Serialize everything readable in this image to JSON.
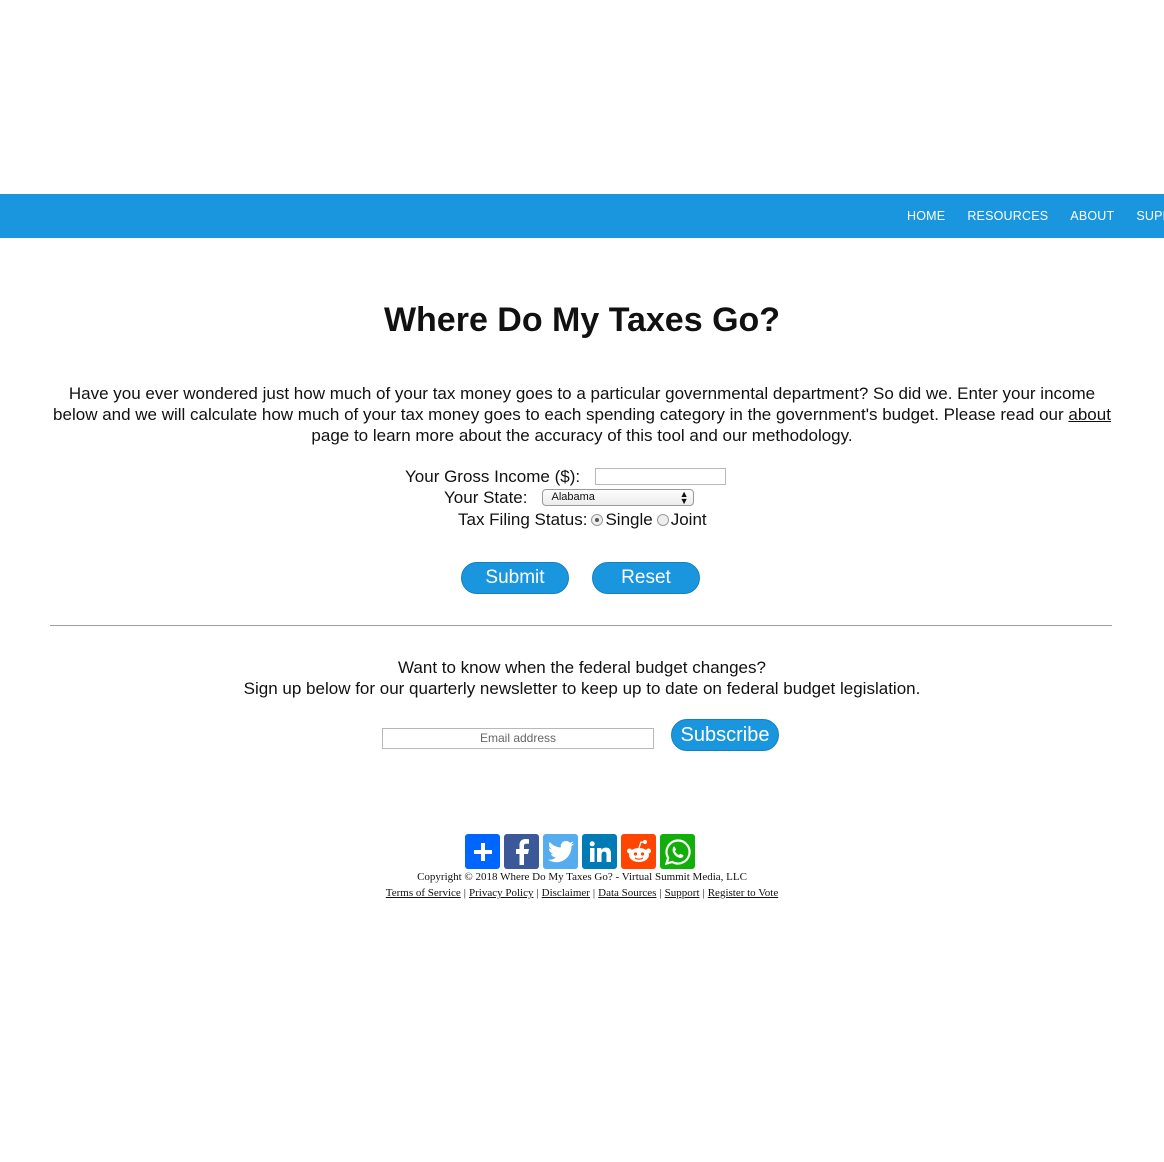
{
  "nav": {
    "items": [
      "HOME",
      "RESOURCES",
      "ABOUT",
      "SUPPORT"
    ]
  },
  "title": "Where Do My Taxes Go?",
  "intro": {
    "text_before": "Have you ever wondered just how much of your tax money goes to a particular governmental department? So did we. Enter your income below and we will calculate how much of your tax money goes to each spending category in the government's budget. Please read our ",
    "link": "about",
    "text_after": " page to learn more about the accuracy of this tool and our methodology."
  },
  "form": {
    "income_label": "Your Gross Income ($):",
    "income_value": "",
    "state_label": "Your State:",
    "state_value": "Alabama",
    "filing_label": "Tax Filing Status:",
    "filing_options": [
      "Single",
      "Joint"
    ],
    "filing_selected": "Single",
    "submit_label": "Submit",
    "reset_label": "Reset"
  },
  "newsletter": {
    "line1": "Want to know when the federal budget changes?",
    "line2": "Sign up below for our quarterly newsletter to keep up to date on federal budget legislation.",
    "email_placeholder": "Email address",
    "subscribe_label": "Subscribe"
  },
  "social": [
    {
      "name": "share-icon",
      "color": "#0166ff"
    },
    {
      "name": "facebook-icon",
      "color": "#3b5998"
    },
    {
      "name": "twitter-icon",
      "color": "#55acee"
    },
    {
      "name": "linkedin-icon",
      "color": "#007bb5"
    },
    {
      "name": "reddit-icon",
      "color": "#ff4500"
    },
    {
      "name": "whatsapp-icon",
      "color": "#12af0a"
    }
  ],
  "footer": {
    "copyright": "Copyright © 2018 Where Do My Taxes Go? - Virtual Summit Media, LLC",
    "links": [
      "Terms of Service",
      "Privacy Policy",
      "Disclaimer",
      "Data Sources",
      "Support",
      "Register to Vote"
    ]
  }
}
